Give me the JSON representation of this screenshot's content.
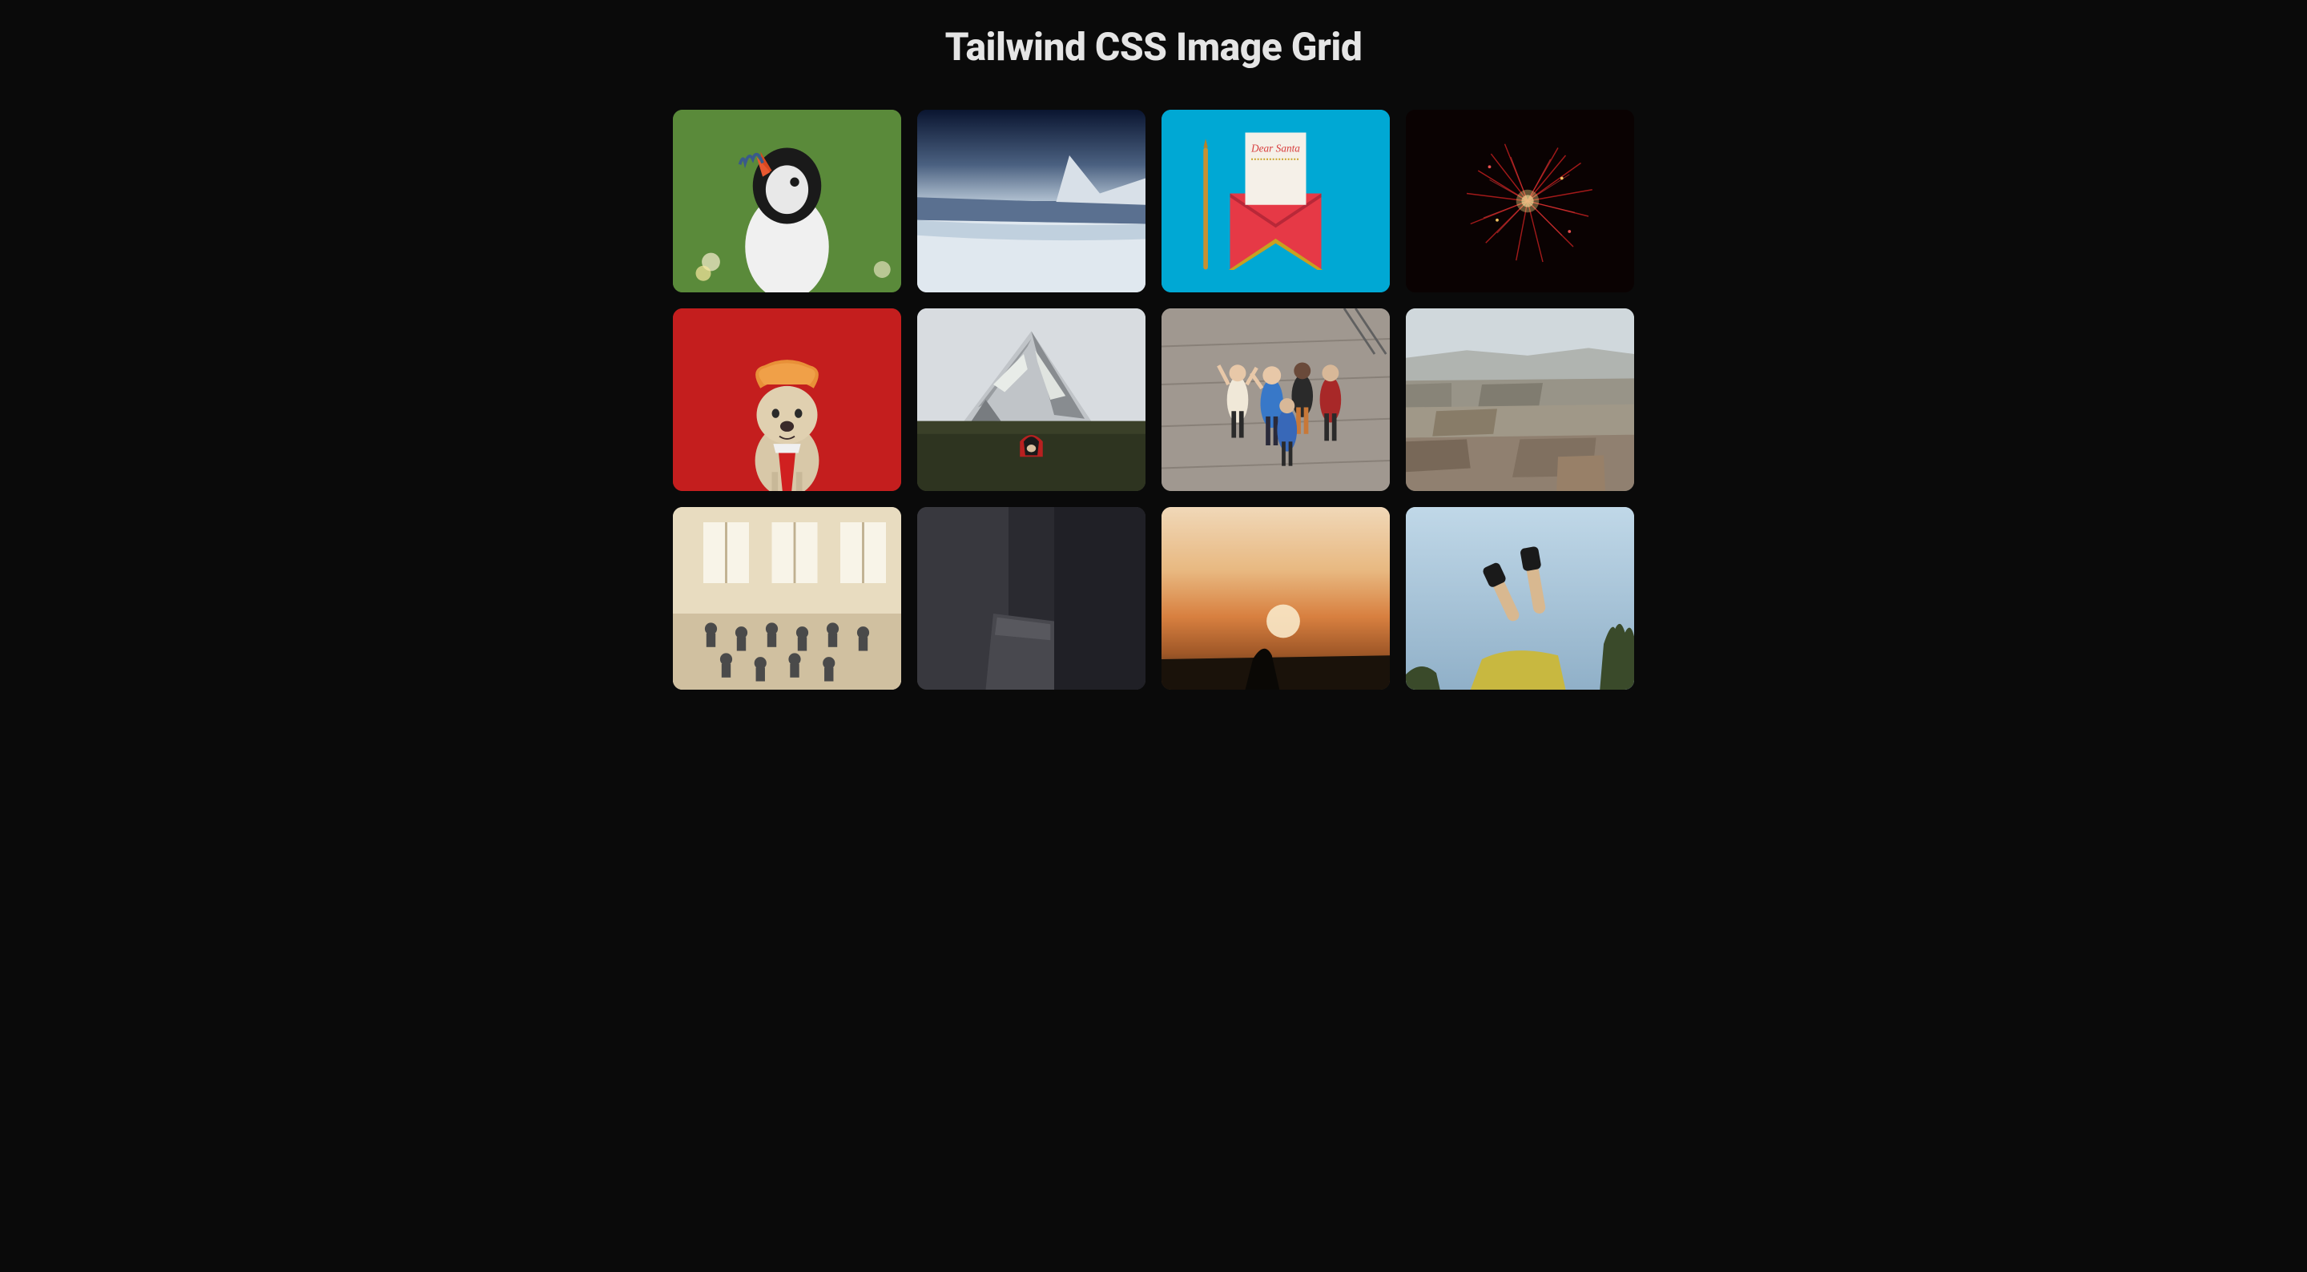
{
  "page": {
    "title": "Tailwind CSS Image Grid"
  },
  "grid": {
    "columns": 4,
    "items": [
      {
        "name": "puffin-bird",
        "alt": "Puffin bird with fish in beak on green background"
      },
      {
        "name": "snowy-lake",
        "alt": "Snowy mountain lake landscape with dark sky"
      },
      {
        "name": "dear-santa",
        "alt": "Dear Santa letter in red envelope on blue background",
        "text": "Dear Santa"
      },
      {
        "name": "red-fireworks",
        "alt": "Red fireworks explosion on dark background"
      },
      {
        "name": "bulldog-red",
        "alt": "French bulldog wearing orange wig and red tie on red background"
      },
      {
        "name": "snowy-mountain",
        "alt": "Snow-covered mountain peak with red tent"
      },
      {
        "name": "friends-group",
        "alt": "Group of friends posing together outdoors"
      },
      {
        "name": "canyon-landscape",
        "alt": "Rocky canyon landscape with layered cliffs"
      },
      {
        "name": "classroom",
        "alt": "Students in classroom with bright windows"
      },
      {
        "name": "dark-room",
        "alt": "Dark interior room"
      },
      {
        "name": "sunset-silhouette",
        "alt": "Silhouette against orange sunset"
      },
      {
        "name": "legs-sky",
        "alt": "Person's legs up against sky with trees"
      }
    ]
  }
}
